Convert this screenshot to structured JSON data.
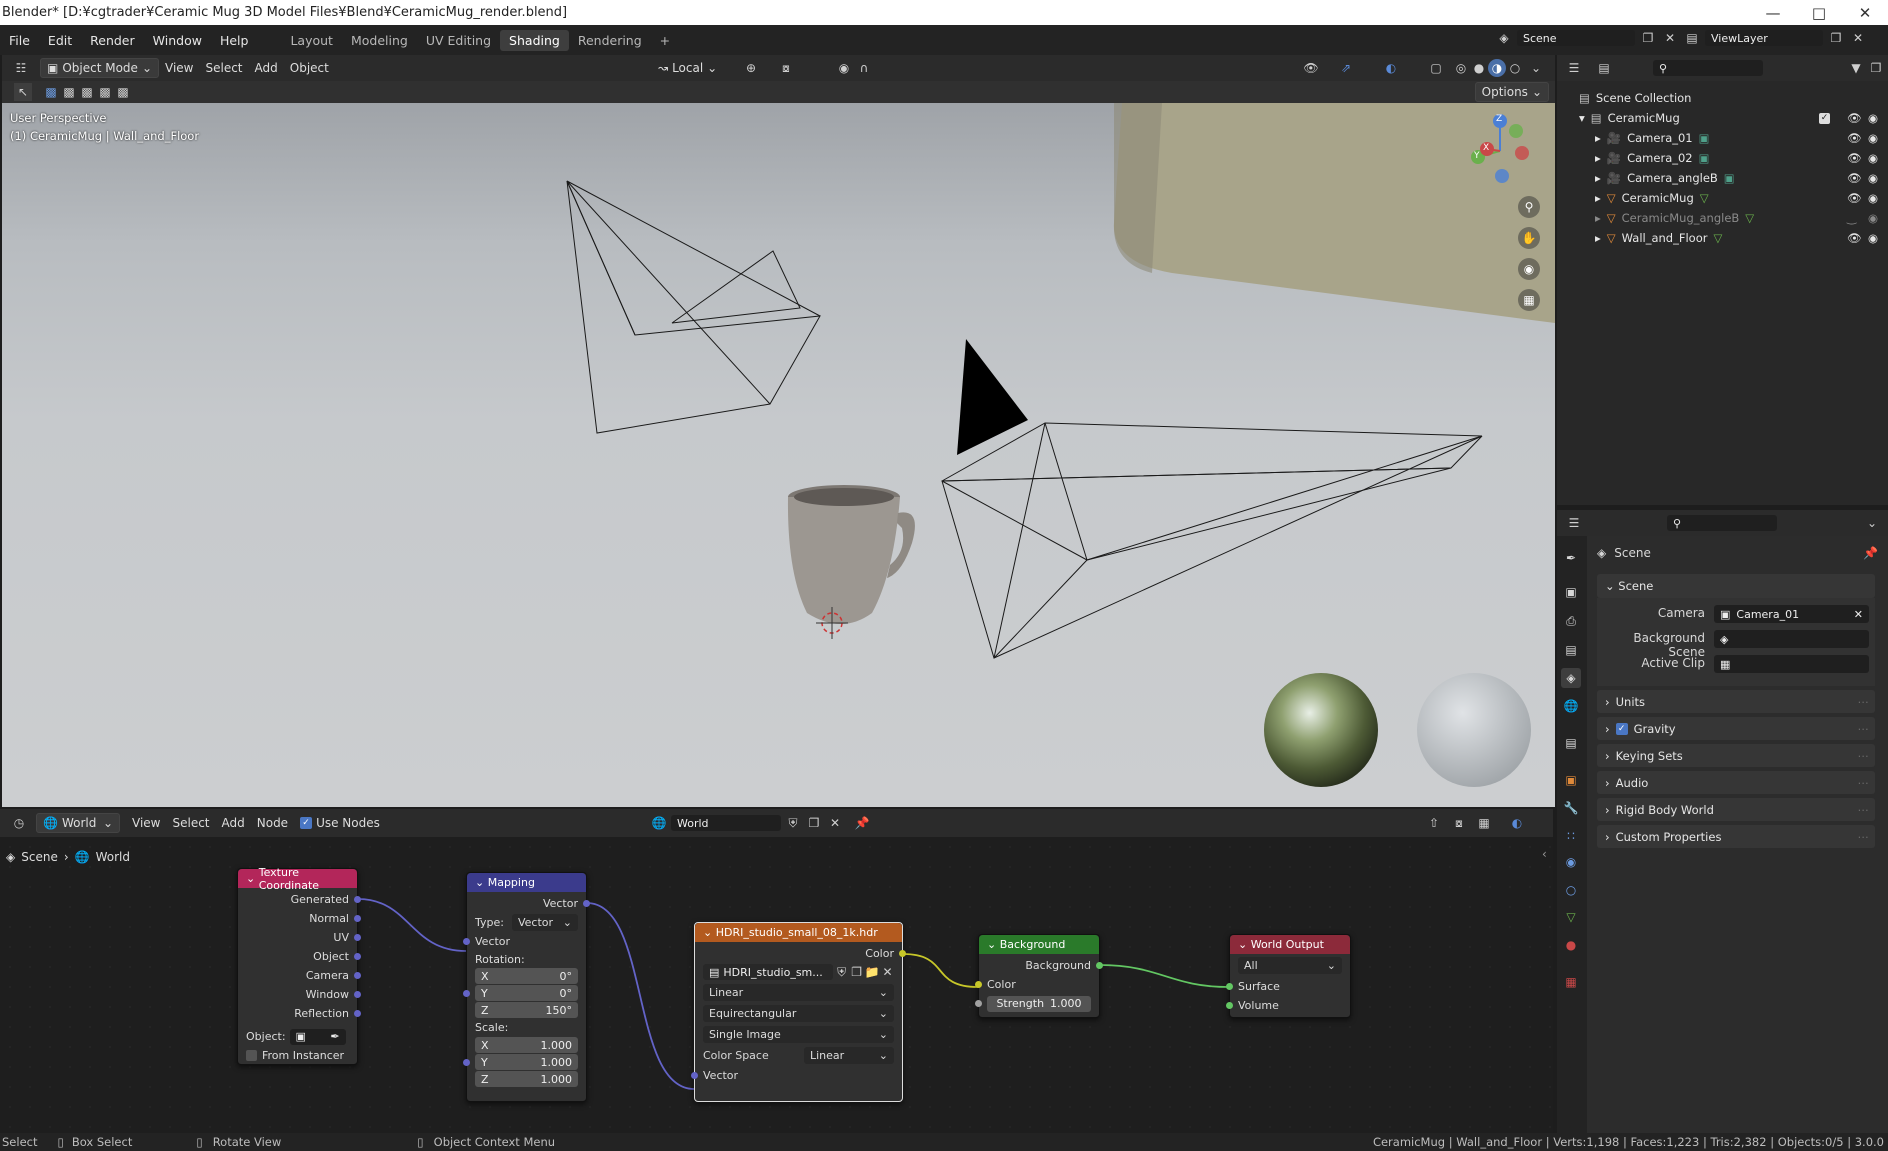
{
  "window": {
    "title": "Blender* [D:¥cgtrader¥Ceramic Mug 3D Model Files¥Blend¥CeramicMug_render.blend]"
  },
  "menu": [
    "File",
    "Edit",
    "Render",
    "Window",
    "Help"
  ],
  "workspaces": [
    "Layout",
    "Modeling",
    "UV Editing",
    "Shading",
    "Rendering"
  ],
  "active_workspace": "Shading",
  "scene_selector": "Scene",
  "viewlayer_selector": "ViewLayer",
  "viewport_header": {
    "mode": "Object Mode",
    "menus": [
      "View",
      "Select",
      "Add",
      "Object"
    ],
    "transform_orientation": "Local",
    "options_label": "Options"
  },
  "viewport": {
    "perspective_label": "User Perspective",
    "object_label": "(1) CeramicMug | Wall_and_Floor",
    "gizmo_axes": [
      "Z",
      "Y",
      "X"
    ]
  },
  "node_editor": {
    "type_label": "World",
    "menus": [
      "View",
      "Select",
      "Add",
      "Node"
    ],
    "use_nodes_label": "Use Nodes",
    "world_name": "World",
    "breadcrumb": [
      "Scene",
      "World"
    ],
    "nodes": {
      "texcoord": {
        "title": "Texture Coordinate",
        "outputs": [
          "Generated",
          "Normal",
          "UV",
          "Object",
          "Camera",
          "Window",
          "Reflection"
        ],
        "object_label": "Object:",
        "from_instancer": "From Instancer"
      },
      "mapping": {
        "title": "Mapping",
        "output": "Vector",
        "type_label": "Type:",
        "type_value": "Vector",
        "input_vector": "Vector",
        "rotation_label": "Rotation:",
        "rotation": [
          {
            "axis": "X",
            "value": "0°"
          },
          {
            "axis": "Y",
            "value": "0°"
          },
          {
            "axis": "Z",
            "value": "150°"
          }
        ],
        "scale_label": "Scale:",
        "scale": [
          {
            "axis": "X",
            "value": "1.000"
          },
          {
            "axis": "Y",
            "value": "1.000"
          },
          {
            "axis": "Z",
            "value": "1.000"
          }
        ]
      },
      "hdri": {
        "title": "HDRI_studio_small_08_1k.hdr",
        "output": "Color",
        "image_name": "HDRI_studio_sm...",
        "interpolation": "Linear",
        "projection": "Equirectangular",
        "source": "Single Image",
        "color_space_label": "Color Space",
        "color_space": "Linear",
        "input_vector": "Vector"
      },
      "background": {
        "title": "Background",
        "output": "Background",
        "input_color": "Color",
        "strength_label": "Strength",
        "strength_value": "1.000"
      },
      "world_output": {
        "title": "World Output",
        "target": "All",
        "inputs": [
          "Surface",
          "Volume"
        ]
      }
    }
  },
  "outliner": {
    "root": "Scene Collection",
    "collection": "CeramicMug",
    "items": [
      {
        "name": "Camera_01",
        "kind": "camera",
        "dim": false
      },
      {
        "name": "Camera_02",
        "kind": "camera",
        "dim": false
      },
      {
        "name": "Camera_angleB",
        "kind": "camera",
        "dim": false
      },
      {
        "name": "CeramicMug",
        "kind": "mesh",
        "dim": false
      },
      {
        "name": "CeramicMug_angleB",
        "kind": "mesh",
        "dim": true
      },
      {
        "name": "Wall_and_Floor",
        "kind": "mesh",
        "dim": false
      }
    ]
  },
  "properties": {
    "context_name": "Scene",
    "section": "Scene",
    "camera_label": "Camera",
    "camera_value": "Camera_01",
    "background_scene_label": "Background Scene",
    "active_clip_label": "Active Clip",
    "panels": [
      "Units",
      "Gravity",
      "Keying Sets",
      "Audio",
      "Rigid Body World",
      "Custom Properties"
    ]
  },
  "statusbar": {
    "select": "Select",
    "box_select": "Box Select",
    "rotate_view": "Rotate View",
    "context_menu": "Object Context Menu",
    "stats": "CeramicMug | Wall_and_Floor | Verts:1,198 | Faces:1,223 | Tris:2,382 | Objects:0/5 | 3.0.0"
  },
  "colors": {
    "texcoord_header": "#b3265a",
    "mapping_header": "#3b3b8c",
    "hdri_header": "#b35a1f",
    "background_header": "#2a7a2a",
    "output_header": "#8c2a3a",
    "active_tab": "#3e3e3e"
  }
}
